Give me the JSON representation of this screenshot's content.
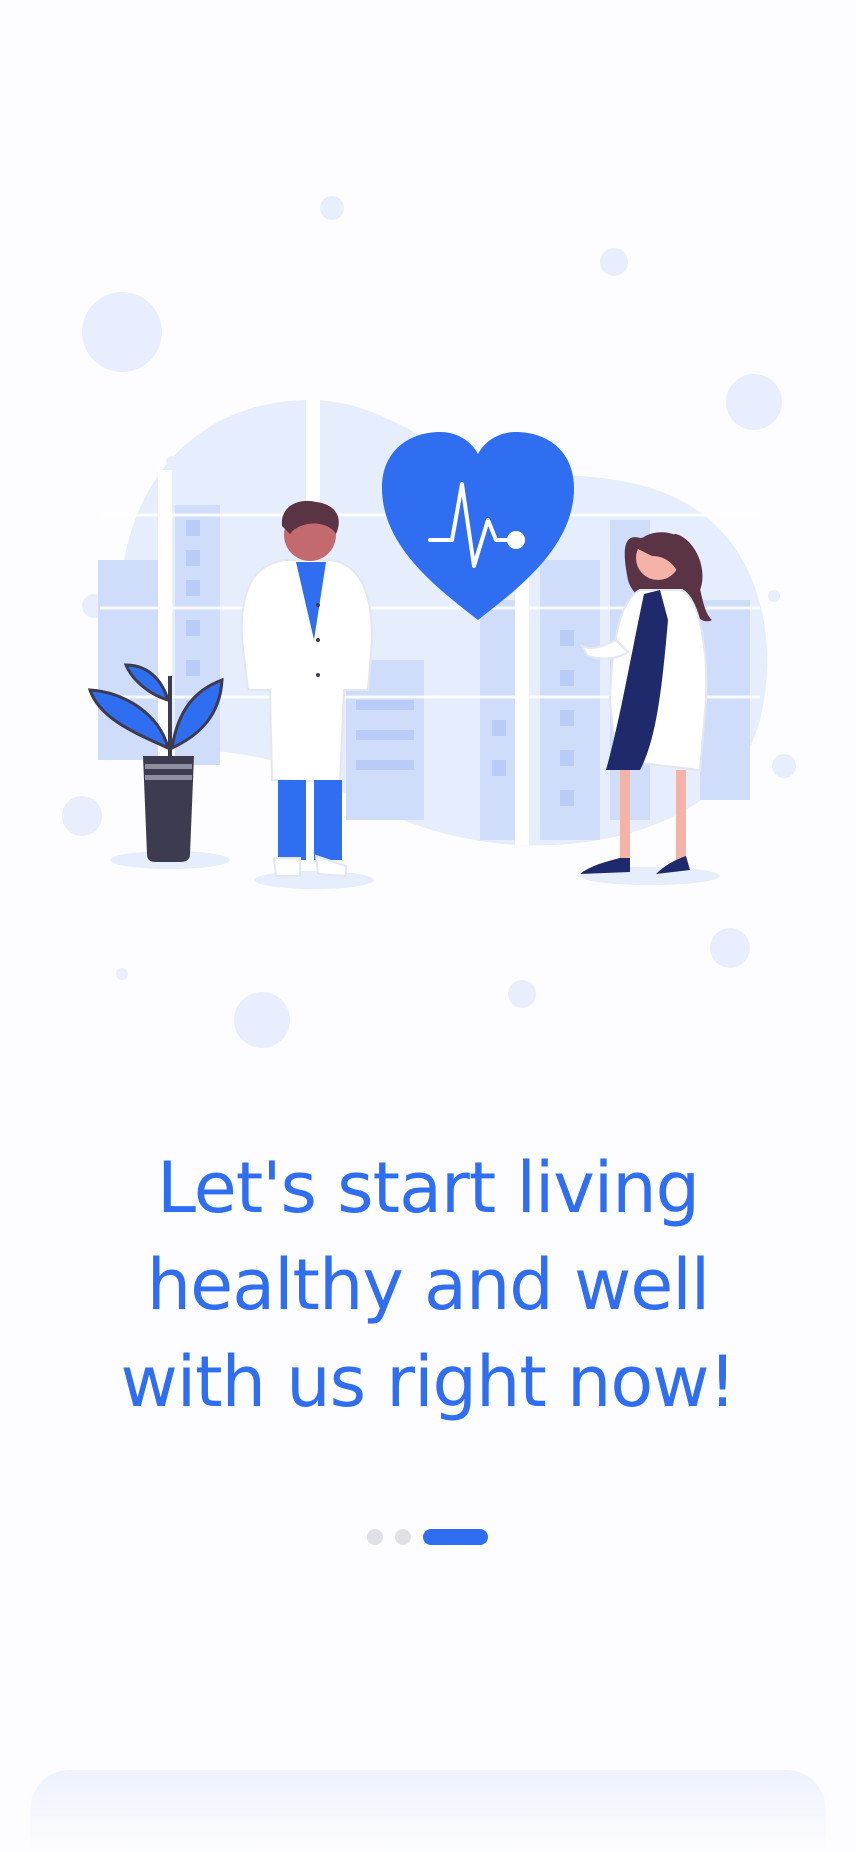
{
  "headline": {
    "line1": "Let's start living",
    "line2": "healthy and well",
    "line3": "with us right now!"
  },
  "pager": {
    "total": 3,
    "active_index": 3
  },
  "colors": {
    "accent": "#2f6df1",
    "bubble": "#e7eefd",
    "scene_bg": "#d9e4fb",
    "inactive_dot": "#dfe1e6"
  }
}
